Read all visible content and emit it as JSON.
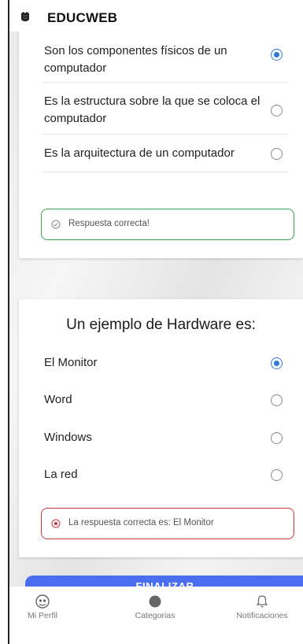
{
  "header": {
    "title": "EDUCWEB"
  },
  "question1": {
    "options": [
      {
        "label": "Son los componentes físicos de un computador",
        "selected": true
      },
      {
        "label": "Es la estructura sobre la que se coloca el computador",
        "selected": false
      },
      {
        "label": "Es la arquitectura de un computador",
        "selected": false
      }
    ],
    "feedback": "Respuesta correcta!"
  },
  "question2": {
    "title": "Un ejemplo de Hardware es:",
    "options": [
      {
        "label": "El Monitor",
        "selected": true
      },
      {
        "label": "Word",
        "selected": false
      },
      {
        "label": "Windows",
        "selected": false
      },
      {
        "label": "La red",
        "selected": false
      }
    ],
    "feedback": "La respuesta correcta es: El Monitor"
  },
  "finish_button": "FINALIZAR",
  "nav": {
    "items": [
      {
        "label": "Mi Perfil",
        "icon": "profile-icon"
      },
      {
        "label": "Categorias",
        "icon": "categories-icon"
      },
      {
        "label": "Notificaciones",
        "icon": "bell-icon"
      }
    ]
  },
  "colors": {
    "accent": "#2d7be0",
    "correct": "#3aa24a",
    "incorrect": "#c9343a",
    "button": "#4b6ef0"
  }
}
